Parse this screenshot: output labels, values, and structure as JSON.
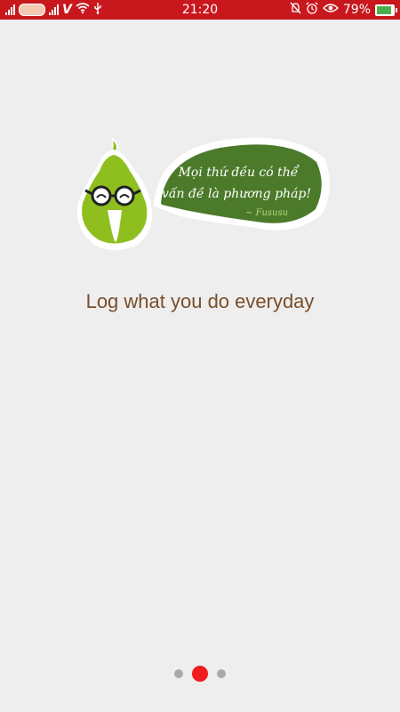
{
  "status_bar": {
    "time": "21:20",
    "battery_percent": "79%",
    "battery_level": 0.79,
    "carrier_label": "Viettel",
    "icons": [
      "signal-icon",
      "carrier-logo",
      "signal-icon",
      "carrier-logo",
      "wifi-icon",
      "usb-icon",
      "alarm-off-icon",
      "alarm-clock-icon",
      "eye-icon",
      "battery-charging-icon"
    ]
  },
  "onboarding": {
    "speech_line1": "Mọi thứ đều có thể",
    "speech_line2": "vấn đề là phương pháp!",
    "speech_signature": "~ Fususu",
    "headline": "Log what you do everyday",
    "page_count": 3,
    "current_page": 2
  },
  "colors": {
    "status_bar": "#c8181e",
    "background": "#eeeeee",
    "headline": "#7a4e2a",
    "bubble": "#4b7a2a",
    "mascot": "#8fbf1f",
    "dot_active": "#ef1d1d",
    "dot_inactive": "#aaaaaa"
  }
}
